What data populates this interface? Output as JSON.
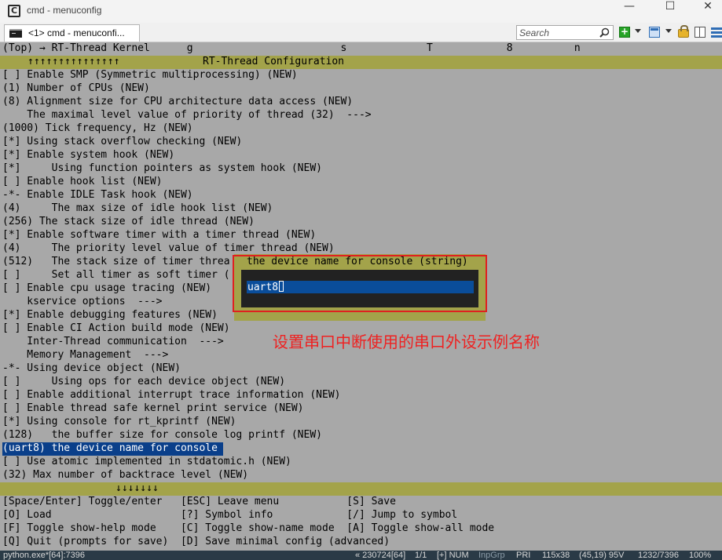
{
  "window": {
    "title": "cmd - menuconfig",
    "controls": {
      "minimize": "—",
      "maximize": "☐",
      "close": "✕"
    }
  },
  "tabs": [
    {
      "label": "<1> cmd - menuconfi..."
    }
  ],
  "search": {
    "placeholder": "Search"
  },
  "toolbar_icons": [
    "search-icon",
    "add-console-icon",
    "window-icon",
    "lock-icon",
    "split-pane-icon",
    "menu-icon"
  ],
  "terminal": {
    "path": "(Top) → RT-Thread Kernel      g                        s             T            8          n",
    "up_arrows": "↑↑↑↑↑↑↑↑↑↑↑↑↑↑↑",
    "header": "RT-Thread Configuration",
    "lines": [
      "[ ] Enable SMP (Symmetric multiprocessing) (NEW)",
      "(1) Number of CPUs (NEW)",
      "(8) Alignment size for CPU architecture data access (NEW)",
      "    The maximal level value of priority of thread (32)  --->",
      "(1000) Tick frequency, Hz (NEW)",
      "[*] Using stack overflow checking (NEW)",
      "[*] Enable system hook (NEW)",
      "[*]     Using function pointers as system hook (NEW)",
      "[ ] Enable hook list (NEW)",
      "-*- Enable IDLE Task hook (NEW)",
      "(4)     The max size of idle hook list (NEW)",
      "(256) The stack size of idle thread (NEW)",
      "[*] Enable software timer with a timer thread (NEW)",
      "(4)     The priority level value of timer thread (NEW)",
      "(512)   The stack size of timer threa",
      "[ ]     Set all timer as soft timer (",
      "[ ] Enable cpu usage tracing (NEW)",
      "    kservice options  --->",
      "[*] Enable debugging features (NEW)",
      "[ ] Enable CI Action build mode (NEW)",
      "    Inter-Thread communication  --->",
      "    Memory Management  --->",
      "-*- Using device object (NEW)",
      "[ ]     Using ops for each device object (NEW)",
      "[ ] Enable additional interrupt trace information (NEW)",
      "[ ] Enable thread safe kernel print service (NEW)",
      "[*] Using console for rt_kprintf (NEW)",
      "(128)   the buffer size for console log printf (NEW)",
      "(uart8) the device name for console",
      "[ ] Use atomic implemented in stdatomic.h (NEW)",
      "(32) Max number of backtrace level (NEW)"
    ],
    "down_arrows": "↓↓↓↓↓↓↓",
    "help": [
      "[Space/Enter] Toggle/enter   [ESC] Leave menu           [S] Save",
      "[O] Load                     [?] Symbol info            [/] Jump to symbol",
      "[F] Toggle show-help mode    [C] Toggle show-name mode  [A] Toggle show-all mode",
      "[Q] Quit (prompts for save)  [D] Save minimal config (advanced)"
    ]
  },
  "dialog": {
    "title": "the device name for console (string)",
    "value": "uart8"
  },
  "annotation": "设置串口中断使用的串口外设示例名称",
  "status": {
    "process": "python.exe*[64]:7396",
    "build": "« 230724[64]",
    "pos": "1/1",
    "num": "[+] NUM",
    "inpgrp": "InpGrp",
    "pri": "PRI",
    "size": "115x38",
    "coord": "(45,19) 95V",
    "pid": "1232/7396",
    "zoom": "100%"
  },
  "colors": {
    "terminal_bg": "#a8a8a8",
    "band": "#a3a34a",
    "selection": "#0a3f8a",
    "annotation": "#e22222"
  }
}
